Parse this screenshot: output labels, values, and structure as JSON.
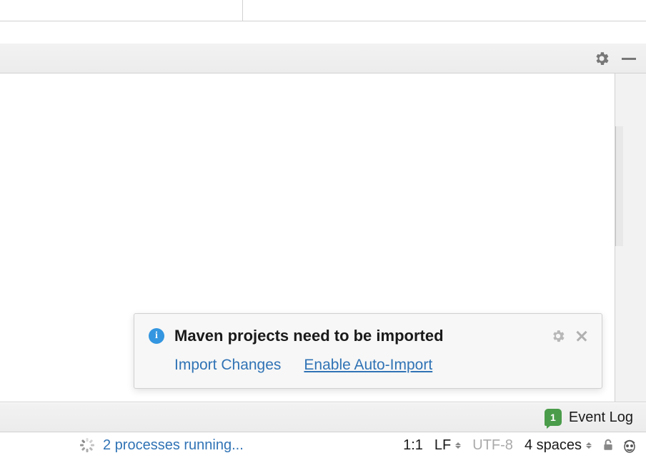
{
  "notification": {
    "title": "Maven projects need to be imported",
    "action_import": "Import Changes",
    "action_enable": "Enable Auto-Import"
  },
  "status": {
    "event_count": "1",
    "event_log_label": "Event Log"
  },
  "footer": {
    "processes_running": "2 processes running...",
    "cursor_position": "1:1",
    "line_separator": "LF",
    "encoding": "UTF-8",
    "indent": "4 spaces"
  }
}
